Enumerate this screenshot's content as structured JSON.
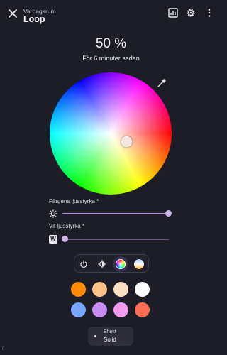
{
  "header": {
    "subtitle": "Vardagsrum",
    "title": "Loop",
    "icons": [
      "close-icon",
      "chart-icon",
      "gear-icon",
      "more-vert-icon"
    ]
  },
  "status": {
    "brightness": "50 %",
    "last_changed": "För 6 minuter sedan"
  },
  "color_wheel": {
    "selected_color": "#f3e6dc"
  },
  "sliders": {
    "color_brightness": {
      "label": "Färgens ljusstyrka *",
      "value_fraction": 1.0,
      "icon": "brightness-icon"
    },
    "white_brightness": {
      "label": "Vit ljusstyrka *",
      "value_fraction": 0.0,
      "icon": "w-icon",
      "icon_text": "W"
    }
  },
  "modes": {
    "items": [
      "power-icon",
      "brightness-auto-icon",
      "color-wheel-icon",
      "color-temp-icon"
    ],
    "active": "color-wheel-icon"
  },
  "favorite_colors": [
    "#ff8c00",
    "#ffc38a",
    "#ffe0c3",
    "#ffffff",
    "#78a6ff",
    "#c88cf2",
    "#f29cf0",
    "#ff6e52"
  ],
  "effect": {
    "label": "Effekt",
    "value": "Solid"
  },
  "corner_text": "0",
  "colors": {
    "accent": "#b794d6",
    "background": "#1c1d27"
  }
}
